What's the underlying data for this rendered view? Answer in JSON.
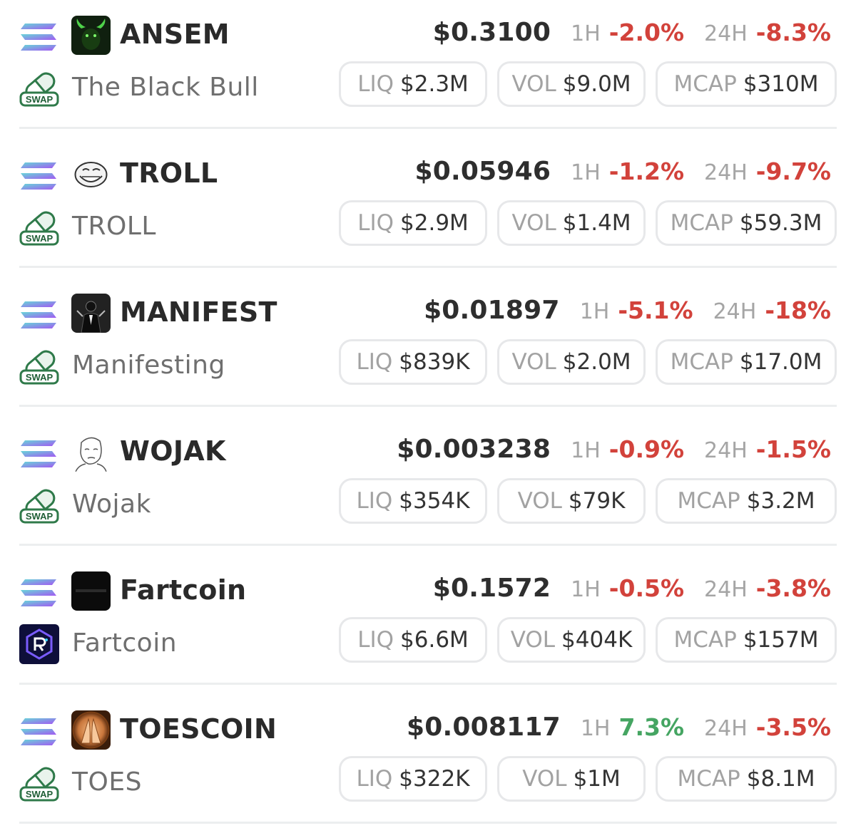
{
  "labels": {
    "h1": "1H",
    "h24": "24H",
    "liq": "LIQ",
    "vol": "VOL",
    "mcap": "MCAP"
  },
  "colors": {
    "negative": "#d2423b",
    "positive": "#45a562",
    "chain_gradient": [
      "#6fe3c6",
      "#9b5cf0"
    ]
  },
  "tokens": [
    {
      "symbol": "ANSEM",
      "name": "The Black Bull",
      "price": "$0.3100",
      "change_1h": "-2.0%",
      "change_1h_dir": "neg",
      "change_24h": "-8.3%",
      "change_24h_dir": "neg",
      "liq": "$2.3M",
      "vol": "$9.0M",
      "mcap": "$310M",
      "logo_icon": "black-bull-icon",
      "dex_icon": "pill-swap-icon",
      "dex_text": "SWAP"
    },
    {
      "symbol": "TROLL",
      "name": "TROLL",
      "price": "$0.05946",
      "change_1h": "-1.2%",
      "change_1h_dir": "neg",
      "change_24h": "-9.7%",
      "change_24h_dir": "neg",
      "liq": "$2.9M",
      "vol": "$1.4M",
      "mcap": "$59.3M",
      "logo_icon": "trollface-icon",
      "dex_icon": "pill-swap-icon",
      "dex_text": "SWAP"
    },
    {
      "symbol": "MANIFEST",
      "name": "Manifesting",
      "price": "$0.01897",
      "change_1h": "-5.1%",
      "change_1h_dir": "neg",
      "change_24h": "-18%",
      "change_24h_dir": "neg",
      "liq": "$839K",
      "vol": "$2.0M",
      "mcap": "$17.0M",
      "logo_icon": "tuxedo-figure-icon",
      "dex_icon": "pill-swap-icon",
      "dex_text": "SWAP"
    },
    {
      "symbol": "WOJAK",
      "name": "Wojak",
      "price": "$0.003238",
      "change_1h": "-0.9%",
      "change_1h_dir": "neg",
      "change_24h": "-1.5%",
      "change_24h_dir": "neg",
      "liq": "$354K",
      "vol": "$79K",
      "mcap": "$3.2M",
      "logo_icon": "wojak-face-icon",
      "dex_icon": "pill-swap-icon",
      "dex_text": "SWAP"
    },
    {
      "symbol": "Fartcoin",
      "name": "Fartcoin",
      "price": "$0.1572",
      "change_1h": "-0.5%",
      "change_1h_dir": "neg",
      "change_24h": "-3.8%",
      "change_24h_dir": "neg",
      "liq": "$6.6M",
      "vol": "$404K",
      "mcap": "$157M",
      "logo_icon": "fartcoin-logo-icon",
      "dex_icon": "raydium-icon",
      "dex_text": ""
    },
    {
      "symbol": "TOESCOIN",
      "name": "TOES",
      "price": "$0.008117",
      "change_1h": "7.3%",
      "change_1h_dir": "pos",
      "change_24h": "-3.5%",
      "change_24h_dir": "neg",
      "liq": "$322K",
      "vol": "$1M",
      "mcap": "$8.1M",
      "logo_icon": "toes-logo-icon",
      "dex_icon": "pill-swap-icon",
      "dex_text": "SWAP"
    }
  ]
}
